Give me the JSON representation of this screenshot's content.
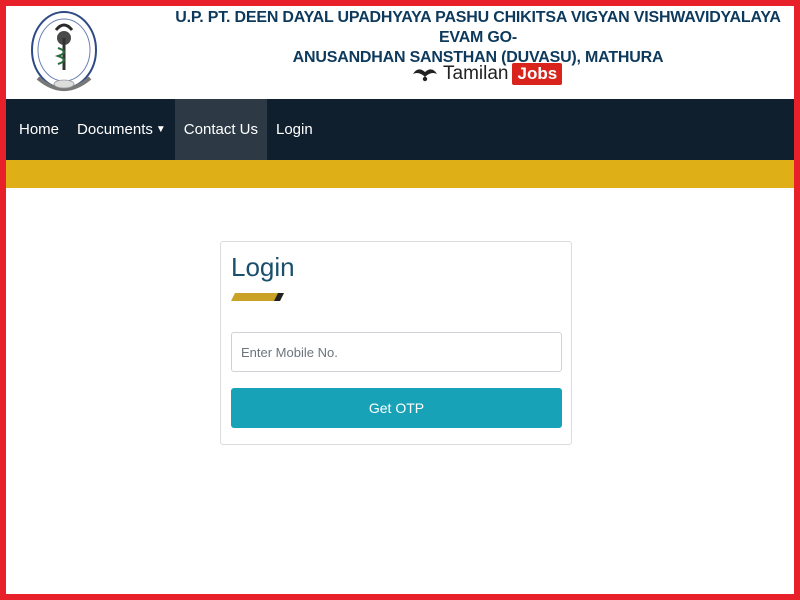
{
  "header": {
    "title_line1": "U.P. PT. DEEN DAYAL UPADHYAYA PASHU CHIKITSA VIGYAN VISHWAVIDYALAYA EVAM GO-",
    "title_line2": "ANUSANDHAN SANSTHAN (DUVASU), MATHURA",
    "brand_tamilan": "Tamilan",
    "brand_jobs": "Jobs"
  },
  "nav": {
    "items": [
      {
        "label": "Home"
      },
      {
        "label": "Documents",
        "caret": "▼"
      },
      {
        "label": "Contact Us",
        "active": true
      },
      {
        "label": "Login"
      }
    ]
  },
  "login": {
    "title": "Login",
    "mobile_placeholder": "Enter Mobile No.",
    "mobile_value": "",
    "button_label": "Get OTP"
  },
  "colors": {
    "frame": "#e8202a",
    "title": "#0d3a5c",
    "navbar": "#0f1f2e",
    "gold_band": "#deaf17",
    "button": "#18a2b8"
  },
  "icons": [
    "university-logo",
    "mustache-icon",
    "caret-down-icon"
  ]
}
